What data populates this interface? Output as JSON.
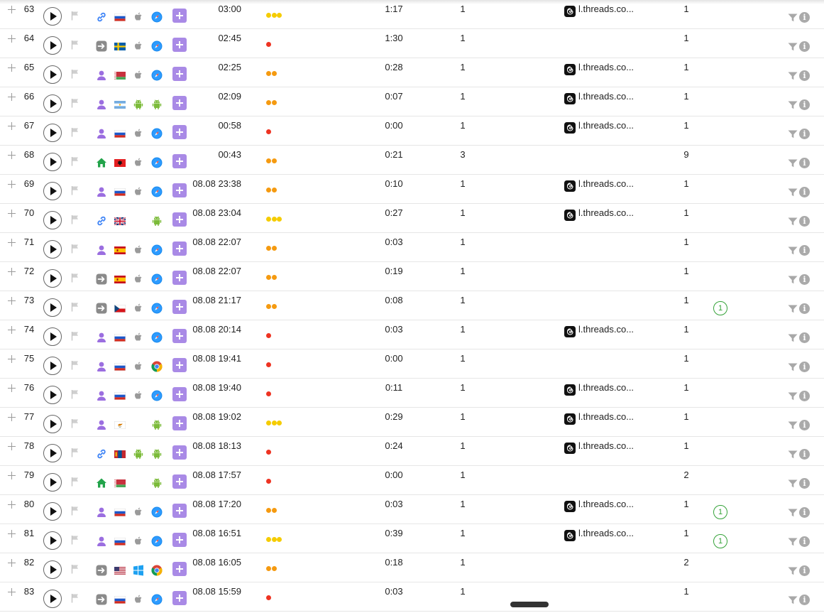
{
  "colors": {
    "add_button": "#a98ae6",
    "dot_red": "#ee3322",
    "dot_orange": "#f59a10",
    "dot_yellow": "#f5cc00",
    "goal_green": "#36a33a"
  },
  "rows": [
    {
      "num": "63",
      "source": "link-icon",
      "country": "ru",
      "os": "apple-icon",
      "browser": "safari-icon",
      "time": "03:00",
      "dots": 3,
      "dur": "1:17",
      "views": "1",
      "referrer": "l.threads.co...",
      "count": "1",
      "goal": ""
    },
    {
      "num": "64",
      "source": "direct-icon",
      "country": "se",
      "os": "apple-icon",
      "browser": "safari-icon",
      "time": "02:45",
      "dots": 1,
      "dur": "1:30",
      "views": "1",
      "referrer": "",
      "count": "1",
      "goal": ""
    },
    {
      "num": "65",
      "source": "social-icon",
      "country": "by",
      "os": "apple-icon",
      "browser": "safari-icon",
      "time": "02:25",
      "dots": 2,
      "dur": "0:28",
      "views": "1",
      "referrer": "l.threads.co...",
      "count": "1",
      "goal": ""
    },
    {
      "num": "66",
      "source": "social-icon",
      "country": "ar",
      "os": "android-icon",
      "browser": "android-icon",
      "time": "02:09",
      "dots": 2,
      "dur": "0:07",
      "views": "1",
      "referrer": "l.threads.co...",
      "count": "1",
      "goal": ""
    },
    {
      "num": "67",
      "source": "social-icon",
      "country": "ru",
      "os": "apple-icon",
      "browser": "safari-icon",
      "time": "00:58",
      "dots": 1,
      "dur": "0:00",
      "views": "1",
      "referrer": "l.threads.co...",
      "count": "1",
      "goal": ""
    },
    {
      "num": "68",
      "source": "home-icon",
      "country": "al",
      "os": "apple-icon",
      "browser": "safari-icon",
      "time": "00:43",
      "dots": 2,
      "dur": "0:21",
      "views": "3",
      "referrer": "",
      "count": "9",
      "goal": ""
    },
    {
      "num": "69",
      "source": "social-icon",
      "country": "ru",
      "os": "apple-icon",
      "browser": "safari-icon",
      "time": "08.08 23:38",
      "dots": 2,
      "dur": "0:10",
      "views": "1",
      "referrer": "l.threads.co...",
      "count": "1",
      "goal": ""
    },
    {
      "num": "70",
      "source": "link-icon",
      "country": "gb",
      "os": "",
      "browser": "android-icon",
      "time": "08.08 23:04",
      "dots": 3,
      "dur": "0:27",
      "views": "1",
      "referrer": "l.threads.co...",
      "count": "1",
      "goal": ""
    },
    {
      "num": "71",
      "source": "social-icon",
      "country": "es",
      "os": "apple-icon",
      "browser": "safari-icon",
      "time": "08.08 22:07",
      "dots": 2,
      "dur": "0:03",
      "views": "1",
      "referrer": "",
      "count": "1",
      "goal": ""
    },
    {
      "num": "72",
      "source": "direct-icon",
      "country": "es",
      "os": "apple-icon",
      "browser": "safari-icon",
      "time": "08.08 22:07",
      "dots": 2,
      "dur": "0:19",
      "views": "1",
      "referrer": "",
      "count": "1",
      "goal": ""
    },
    {
      "num": "73",
      "source": "direct-icon",
      "country": "cz",
      "os": "apple-icon",
      "browser": "safari-icon",
      "time": "08.08 21:17",
      "dots": 2,
      "dur": "0:08",
      "views": "1",
      "referrer": "",
      "count": "1",
      "goal": "1"
    },
    {
      "num": "74",
      "source": "social-icon",
      "country": "ru",
      "os": "apple-icon",
      "browser": "safari-icon",
      "time": "08.08 20:14",
      "dots": 1,
      "dur": "0:03",
      "views": "1",
      "referrer": "l.threads.co...",
      "count": "1",
      "goal": ""
    },
    {
      "num": "75",
      "source": "social-icon",
      "country": "ru",
      "os": "apple-icon",
      "browser": "chrome-icon",
      "time": "08.08 19:41",
      "dots": 1,
      "dur": "0:00",
      "views": "1",
      "referrer": "",
      "count": "1",
      "goal": ""
    },
    {
      "num": "76",
      "source": "social-icon",
      "country": "ru",
      "os": "apple-icon",
      "browser": "safari-icon",
      "time": "08.08 19:40",
      "dots": 1,
      "dur": "0:11",
      "views": "1",
      "referrer": "l.threads.co...",
      "count": "1",
      "goal": ""
    },
    {
      "num": "77",
      "source": "social-icon",
      "country": "cy",
      "os": "",
      "browser": "android-icon",
      "time": "08.08 19:02",
      "dots": 3,
      "dur": "0:29",
      "views": "1",
      "referrer": "l.threads.co...",
      "count": "1",
      "goal": ""
    },
    {
      "num": "78",
      "source": "link-icon",
      "country": "mn",
      "os": "android-icon",
      "browser": "android-icon",
      "time": "08.08 18:13",
      "dots": 1,
      "dur": "0:24",
      "views": "1",
      "referrer": "l.threads.co...",
      "count": "1",
      "goal": ""
    },
    {
      "num": "79",
      "source": "home-icon",
      "country": "by",
      "os": "",
      "browser": "android-icon",
      "time": "08.08 17:57",
      "dots": 1,
      "dur": "0:00",
      "views": "1",
      "referrer": "",
      "count": "2",
      "goal": ""
    },
    {
      "num": "80",
      "source": "social-icon",
      "country": "ru",
      "os": "apple-icon",
      "browser": "safari-icon",
      "time": "08.08 17:20",
      "dots": 2,
      "dur": "0:03",
      "views": "1",
      "referrer": "l.threads.co...",
      "count": "1",
      "goal": "1"
    },
    {
      "num": "81",
      "source": "social-icon",
      "country": "ru",
      "os": "apple-icon",
      "browser": "safari-icon",
      "time": "08.08 16:51",
      "dots": 3,
      "dur": "0:39",
      "views": "1",
      "referrer": "l.threads.co...",
      "count": "1",
      "goal": "1"
    },
    {
      "num": "82",
      "source": "direct-icon",
      "country": "us",
      "os": "windows-icon",
      "browser": "chrome-icon",
      "time": "08.08 16:05",
      "dots": 2,
      "dur": "0:18",
      "views": "1",
      "referrer": "",
      "count": "2",
      "goal": ""
    },
    {
      "num": "83",
      "source": "direct-icon",
      "country": "ru",
      "os": "apple-icon",
      "browser": "safari-icon",
      "time": "08.08 15:59",
      "dots": 1,
      "dur": "0:03",
      "views": "1",
      "referrer": "",
      "count": "1",
      "goal": ""
    }
  ]
}
